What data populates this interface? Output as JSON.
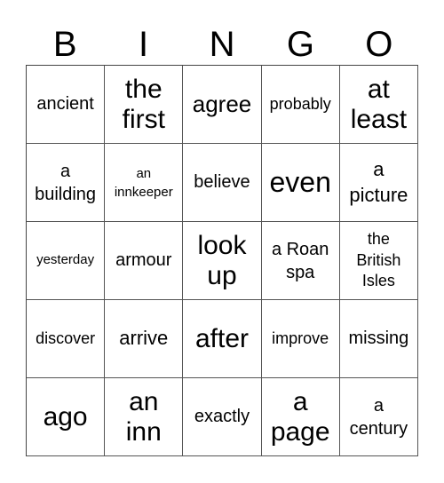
{
  "header": {
    "letters": [
      "B",
      "I",
      "N",
      "G",
      "O"
    ]
  },
  "grid": {
    "rows": [
      [
        "ancient",
        "the first",
        "agree",
        "probably",
        "at least"
      ],
      [
        "a building",
        "an innkeeper",
        "believe",
        "even",
        "a picture"
      ],
      [
        "yesterday",
        "armour",
        "look up",
        "a Roan spa",
        "the British Isles"
      ],
      [
        "discover",
        "arrive",
        "after",
        "improve",
        "missing"
      ],
      [
        "ago",
        "an inn",
        "exactly",
        "a page",
        "a century"
      ]
    ]
  }
}
